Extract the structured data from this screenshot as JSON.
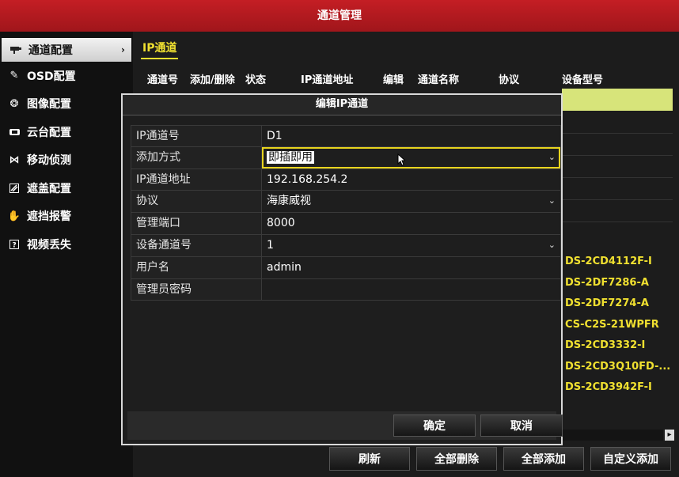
{
  "window": {
    "title": "通道管理"
  },
  "sidebar": {
    "items": [
      {
        "label": "通道配置",
        "icon": "camera-icon",
        "active": true
      },
      {
        "label": "OSD配置",
        "icon": "pencil-icon"
      },
      {
        "label": "图像配置",
        "icon": "palette-icon"
      },
      {
        "label": "云台配置",
        "icon": "ptz-icon"
      },
      {
        "label": "移动侦测",
        "icon": "running-person-icon"
      },
      {
        "label": "遮盖配置",
        "icon": "mask-icon"
      },
      {
        "label": "遮挡报警",
        "icon": "hand-icon"
      },
      {
        "label": "视频丢失",
        "icon": "video-loss-icon"
      }
    ]
  },
  "main": {
    "tab": "IP通道",
    "columns": [
      "通道号",
      "添加/删除",
      "状态",
      "IP通道地址",
      "编辑",
      "通道名称",
      "协议",
      "设备型号"
    ],
    "device_models": [
      "DS-2CD4112F-I",
      "DS-2DF7286-A",
      "DS-2DF7274-A",
      "CS-C2S-21WPFR",
      "DS-2CD3332-I",
      "DS-2CD3Q10FD-...",
      "DS-2CD3942F-I"
    ],
    "buttons": {
      "refresh": "刷新",
      "delete_all": "全部删除",
      "add_all": "全部添加",
      "custom_add": "自定义添加"
    }
  },
  "dialog": {
    "title": "编辑IP通道",
    "fields": [
      {
        "label": "IP通道号",
        "value": "D1"
      },
      {
        "label": "添加方式",
        "value": "即插即用",
        "dropdown": true,
        "selected": true
      },
      {
        "label": "IP通道地址",
        "value": "192.168.254.2"
      },
      {
        "label": "协议",
        "value": "海康威视",
        "dropdown": true
      },
      {
        "label": "管理端口",
        "value": "8000"
      },
      {
        "label": "设备通道号",
        "value": "1",
        "dropdown": true
      },
      {
        "label": "用户名",
        "value": "admin"
      },
      {
        "label": "管理员密码",
        "value": ""
      }
    ],
    "ok": "确定",
    "cancel": "取消"
  },
  "colors": {
    "title_bar": "#b31b21",
    "accent_yellow": "#f0e030",
    "highlight_row": "#d7e47a"
  }
}
